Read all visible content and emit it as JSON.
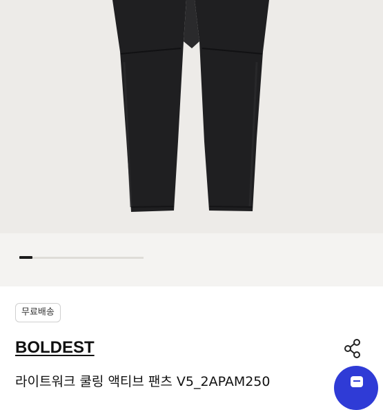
{
  "product": {
    "badge": "무료배송",
    "brand": "BOLDEST",
    "title": "라이트워크 쿨링 액티브 팬츠 V5_2APAM250"
  },
  "carousel": {
    "current_page": 1
  },
  "icons": {
    "share": "share-icon",
    "fab": "chat-icon"
  },
  "colors": {
    "fab": "#2f3bd6",
    "pants": "#1e1e20"
  }
}
